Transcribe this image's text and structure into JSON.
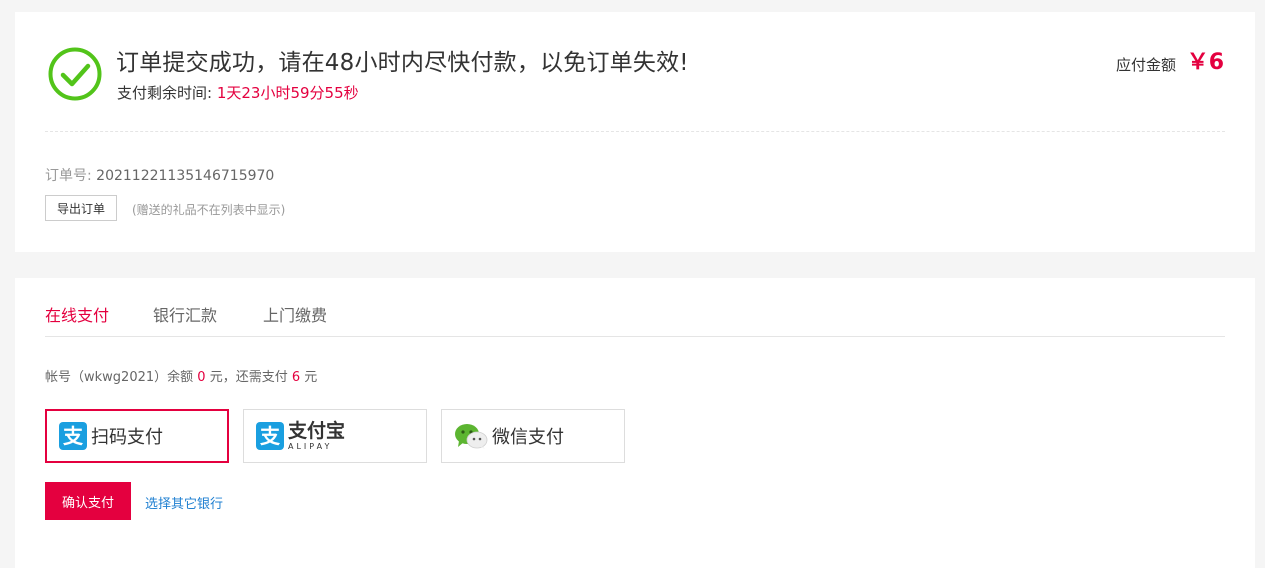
{
  "order": {
    "headline": "订单提交成功，请在48小时内尽快付款，以免订单失效!",
    "remain_label": "支付剩余时间:",
    "remain_time": "1天23小时59分55秒",
    "amount_label": "应付金额",
    "amount_value": "￥6",
    "order_no_label": "订单号:",
    "order_no": "20211221135146715970",
    "export_button": "导出订单",
    "gift_note": "(赠送的礼品不在列表中显示)"
  },
  "payment": {
    "tabs": [
      {
        "label": "在线支付",
        "active": true
      },
      {
        "label": "银行汇款",
        "active": false
      },
      {
        "label": "上门缴费",
        "active": false
      }
    ],
    "account_prefix": "帐号（wkwg2021）余额",
    "balance": "0",
    "account_mid": "元，还需支付",
    "need_pay": "6",
    "account_suffix": "元",
    "options": [
      {
        "label": "扫码支付",
        "icon": "alipay-icon",
        "selected": true
      },
      {
        "label": "支付宝",
        "sublabel": "ALIPAY",
        "icon": "alipay-icon",
        "selected": false
      },
      {
        "label": "微信支付",
        "icon": "wechat-icon",
        "selected": false
      }
    ],
    "confirm_button": "确认支付",
    "other_bank_link": "选择其它银行"
  },
  "colors": {
    "accent": "#e4003f",
    "success": "#52c41a",
    "link": "#1e7fd1",
    "alipay": "#1a9fe0"
  }
}
